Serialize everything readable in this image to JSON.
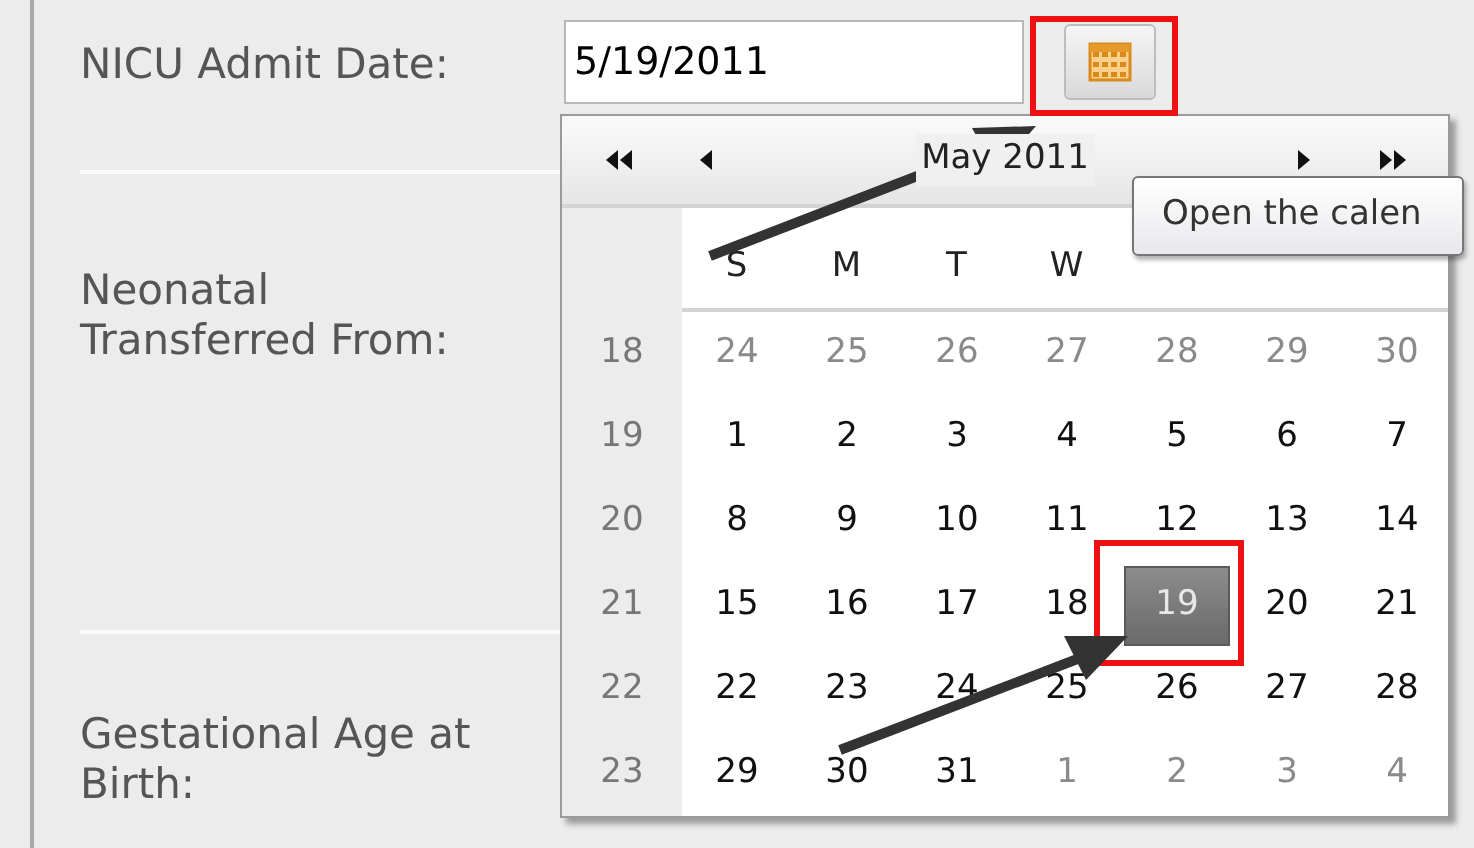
{
  "fields": [
    {
      "label": "NICU Admit Date:",
      "value": "5/19/2011",
      "kind": "date"
    },
    {
      "label": "Neonatal Transferred From:",
      "kind": "empty"
    },
    {
      "label": "Gestational Age at Birth:",
      "kind": "empty"
    }
  ],
  "calendar": {
    "title": "May 2011",
    "weekdays": [
      "S",
      "M",
      "T",
      "W"
    ],
    "weeks": [
      {
        "week": "18",
        "days": [
          {
            "day": "24",
            "in_month": false,
            "selected": false
          },
          {
            "day": "25",
            "in_month": false,
            "selected": false
          },
          {
            "day": "26",
            "in_month": false,
            "selected": false
          },
          {
            "day": "27",
            "in_month": false,
            "selected": false
          },
          {
            "day": "28",
            "in_month": false,
            "selected": false
          },
          {
            "day": "29",
            "in_month": false,
            "selected": false
          },
          {
            "day": "30",
            "in_month": false,
            "selected": false
          }
        ]
      },
      {
        "week": "19",
        "days": [
          {
            "day": "1",
            "in_month": true,
            "selected": false
          },
          {
            "day": "2",
            "in_month": true,
            "selected": false
          },
          {
            "day": "3",
            "in_month": true,
            "selected": false
          },
          {
            "day": "4",
            "in_month": true,
            "selected": false
          },
          {
            "day": "5",
            "in_month": true,
            "selected": false
          },
          {
            "day": "6",
            "in_month": true,
            "selected": false
          },
          {
            "day": "7",
            "in_month": true,
            "selected": false
          }
        ]
      },
      {
        "week": "20",
        "days": [
          {
            "day": "8",
            "in_month": true,
            "selected": false
          },
          {
            "day": "9",
            "in_month": true,
            "selected": false
          },
          {
            "day": "10",
            "in_month": true,
            "selected": false
          },
          {
            "day": "11",
            "in_month": true,
            "selected": false
          },
          {
            "day": "12",
            "in_month": true,
            "selected": false
          },
          {
            "day": "13",
            "in_month": true,
            "selected": false
          },
          {
            "day": "14",
            "in_month": true,
            "selected": false
          }
        ]
      },
      {
        "week": "21",
        "days": [
          {
            "day": "15",
            "in_month": true,
            "selected": false
          },
          {
            "day": "16",
            "in_month": true,
            "selected": false
          },
          {
            "day": "17",
            "in_month": true,
            "selected": false
          },
          {
            "day": "18",
            "in_month": true,
            "selected": false
          },
          {
            "day": "19",
            "in_month": true,
            "selected": true
          },
          {
            "day": "20",
            "in_month": true,
            "selected": false
          },
          {
            "day": "21",
            "in_month": true,
            "selected": false
          }
        ]
      },
      {
        "week": "22",
        "days": [
          {
            "day": "22",
            "in_month": true,
            "selected": false
          },
          {
            "day": "23",
            "in_month": true,
            "selected": false
          },
          {
            "day": "24",
            "in_month": true,
            "selected": false
          },
          {
            "day": "25",
            "in_month": true,
            "selected": false
          },
          {
            "day": "26",
            "in_month": true,
            "selected": false
          },
          {
            "day": "27",
            "in_month": true,
            "selected": false
          },
          {
            "day": "28",
            "in_month": true,
            "selected": false
          }
        ]
      },
      {
        "week": "23",
        "days": [
          {
            "day": "29",
            "in_month": true,
            "selected": false
          },
          {
            "day": "30",
            "in_month": true,
            "selected": false
          },
          {
            "day": "31",
            "in_month": true,
            "selected": false
          },
          {
            "day": "1",
            "in_month": false,
            "selected": false
          },
          {
            "day": "2",
            "in_month": false,
            "selected": false
          },
          {
            "day": "3",
            "in_month": false,
            "selected": false
          },
          {
            "day": "4",
            "in_month": false,
            "selected": false
          }
        ]
      }
    ]
  },
  "tooltip": "Open the calen"
}
